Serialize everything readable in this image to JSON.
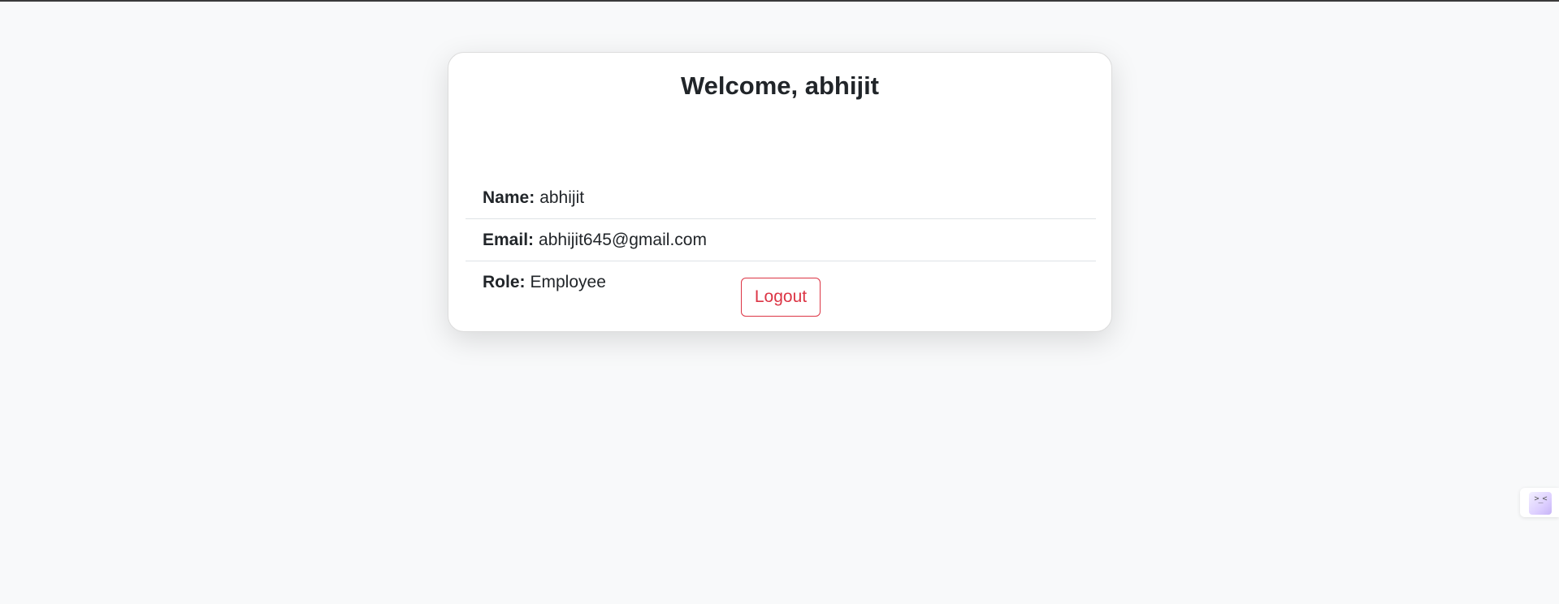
{
  "header": {
    "title": "Welcome, abhijit"
  },
  "profile": {
    "items": [
      {
        "label": "Name:",
        "value": "abhijit"
      },
      {
        "label": "Email:",
        "value": "abhijit645@gmail.com"
      },
      {
        "label": "Role:",
        "value": "Employee"
      }
    ]
  },
  "actions": {
    "logout_label": "Logout"
  },
  "extension": {
    "glyph": ">_<",
    "icon": "extension-face-icon"
  },
  "colors": {
    "background": "#f8f9fa",
    "danger": "#dc3545",
    "text": "#212529"
  }
}
